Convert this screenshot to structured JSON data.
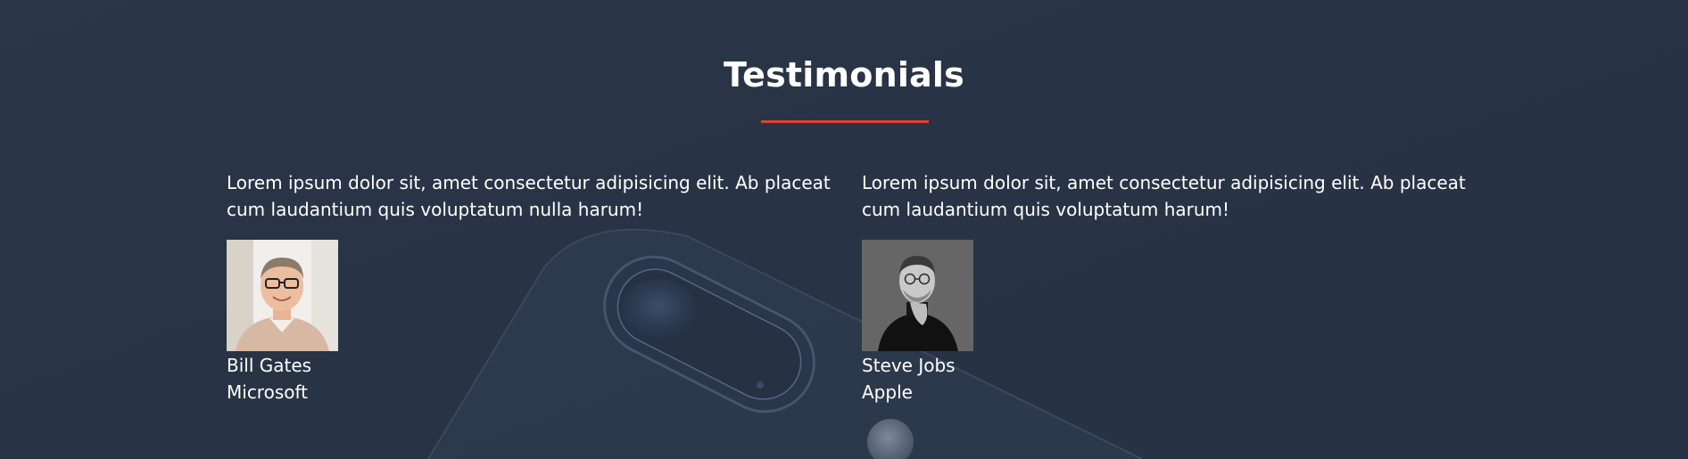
{
  "section": {
    "title": "Testimonials",
    "accent_color": "#e0432b",
    "background_color": "#283445"
  },
  "testimonials": [
    {
      "quote": "Lorem ipsum dolor sit, amet consectetur adipisicing elit. Ab placeat cum laudantium quis voluptatum nulla harum!",
      "name": "Bill Gates",
      "company": "Microsoft",
      "photo_icon": "person-photo"
    },
    {
      "quote": "Lorem ipsum dolor sit, amet consectetur adipisicing elit. Ab placeat cum laudantium quis voluptatum harum!",
      "name": "Steve Jobs",
      "company": "Apple",
      "photo_icon": "person-photo-bw"
    }
  ]
}
